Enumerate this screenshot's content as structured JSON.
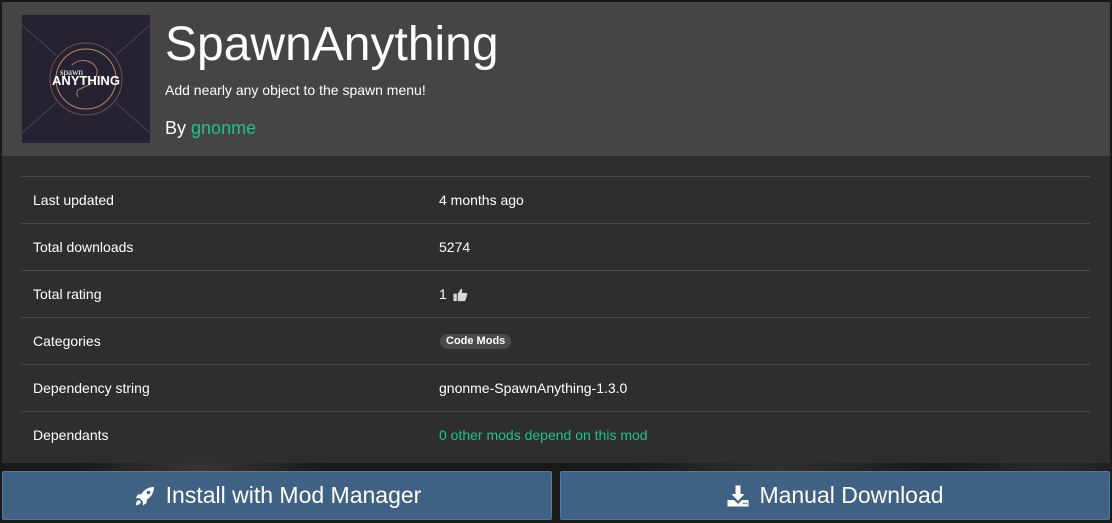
{
  "mod": {
    "name": "SpawnAnything",
    "description": "Add nearly any object to the spawn menu!",
    "by_label": "By",
    "author": "gnonme",
    "logo": {
      "small_text": "spawn",
      "big_text": "ANYTHING",
      "background": "#272232",
      "accent": "#c8a070"
    }
  },
  "details": [
    {
      "label": "Last updated",
      "value": "4 months ago"
    },
    {
      "label": "Total downloads",
      "value": "5274"
    },
    {
      "label": "Total rating",
      "value": "1",
      "icon": "thumbs-up-icon"
    },
    {
      "label": "Categories",
      "badge": "Code Mods"
    },
    {
      "label": "Dependency string",
      "value": "gnonme-SpawnAnything-1.3.0"
    },
    {
      "label": "Dependants",
      "link": "0 other mods depend on this mod"
    }
  ],
  "buttons": {
    "install": {
      "label": "Install with Mod Manager",
      "icon": "rocket-icon"
    },
    "download": {
      "label": "Manual Download",
      "icon": "download-icon"
    }
  },
  "colors": {
    "accent_green": "#21c18e",
    "button_blue": "#3f6184",
    "header_bg": "#454545",
    "card_bg": "#2e2e2e"
  }
}
